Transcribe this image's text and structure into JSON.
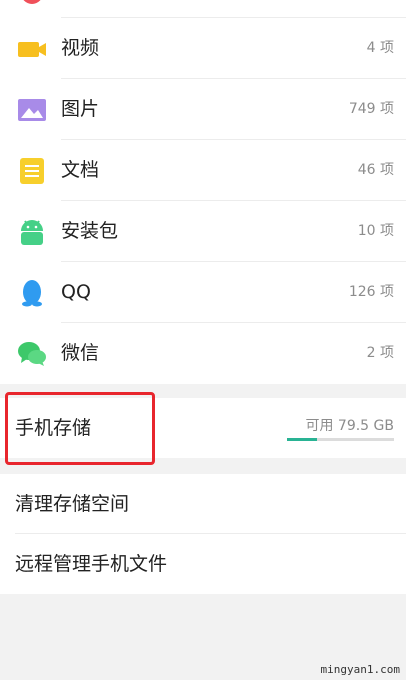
{
  "categories": [
    {
      "label": "视频",
      "count": "4 项",
      "icon": "video-icon",
      "color": "#f7bf1f"
    },
    {
      "label": "图片",
      "count": "749 项",
      "icon": "image-icon",
      "color": "#a88be8"
    },
    {
      "label": "文档",
      "count": "46 项",
      "icon": "document-icon",
      "color": "#f7cf2c"
    },
    {
      "label": "安装包",
      "count": "10 项",
      "icon": "android-icon",
      "color": "#45d087"
    },
    {
      "label": "QQ",
      "count": "126 项",
      "icon": "qq-penguin-icon",
      "color": "#2f9bf0"
    },
    {
      "label": "微信",
      "count": "2 项",
      "icon": "wechat-icon",
      "color": "#3dc86a"
    }
  ],
  "storage": {
    "title": "手机存储",
    "available": "可用 79.5 GB",
    "used_fraction": 0.28,
    "bar_color": "#29b394",
    "highlight_color": "#e8262d"
  },
  "actions": [
    {
      "label": "清理存储空间"
    },
    {
      "label": "远程管理手机文件"
    }
  ],
  "watermark": "mingyan1.com"
}
